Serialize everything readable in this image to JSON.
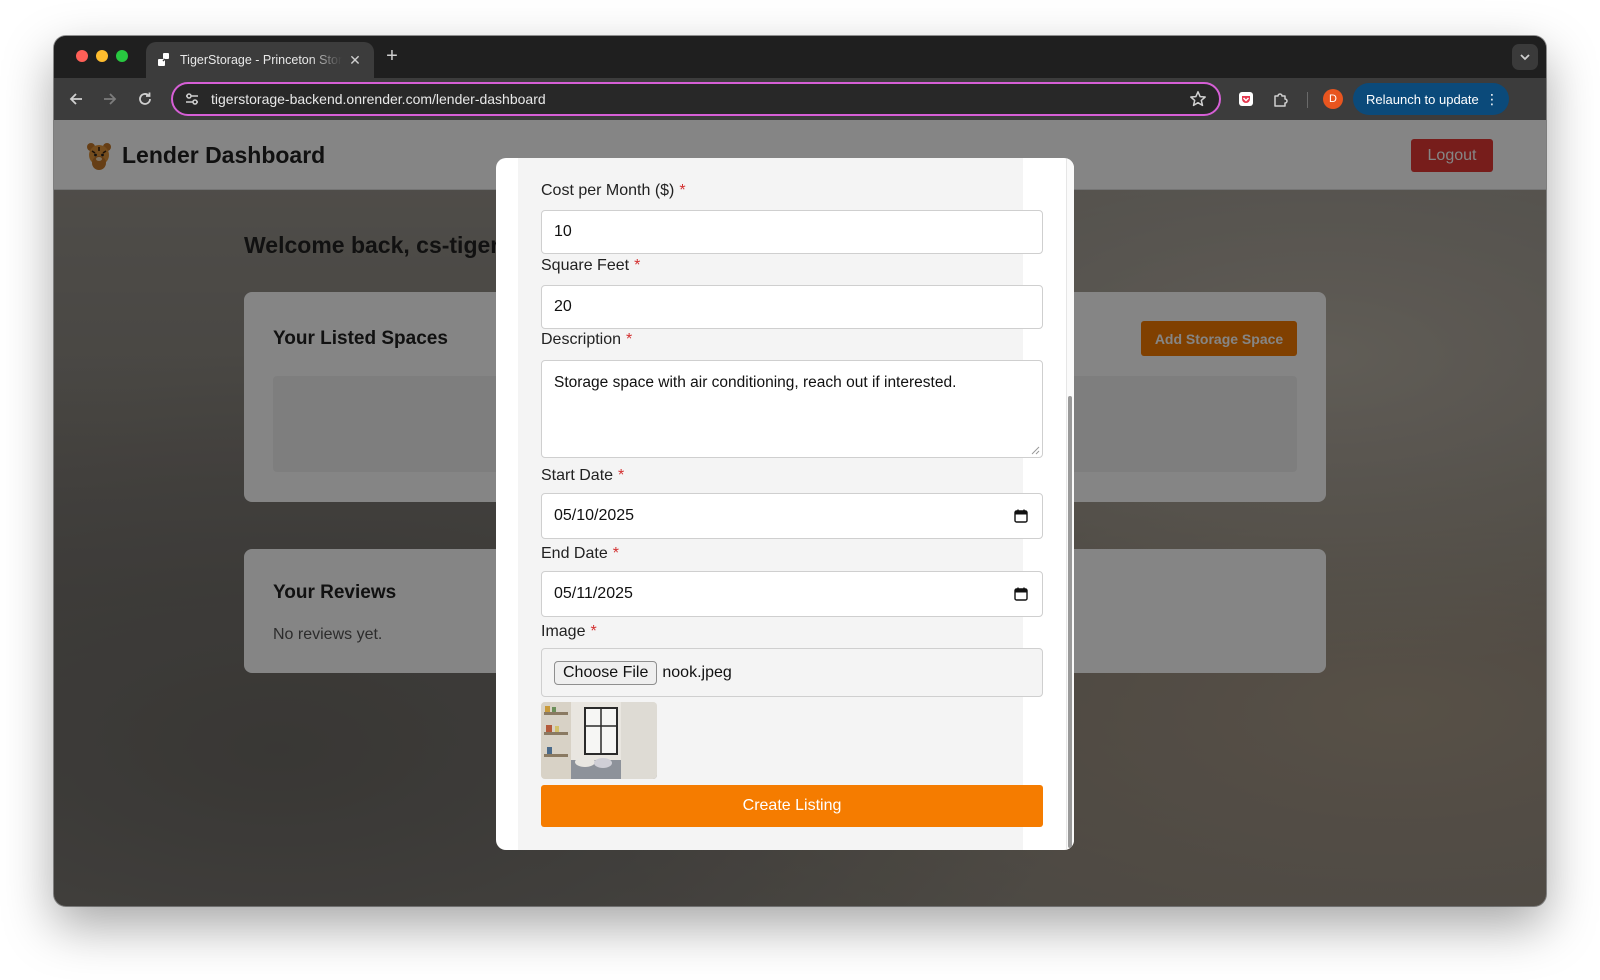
{
  "browser": {
    "tab_title": "TigerStorage - Princeton Storage",
    "url": "tigerstorage-backend.onrender.com/lender-dashboard",
    "relaunch_label": "Relaunch to update",
    "profile_initial": "D"
  },
  "header": {
    "title": "Lender Dashboard",
    "logout_label": "Logout"
  },
  "dashboard": {
    "welcome": "Welcome back, cs-tiger",
    "listed_title": "Your Listed Spaces",
    "add_space_label": "Add Storage Space",
    "reviews_title": "Your Reviews",
    "no_reviews": "No reviews yet."
  },
  "form": {
    "required_mark": "*",
    "cost_label": "Cost per Month ($)",
    "cost_value": "10",
    "sqft_label": "Square Feet",
    "sqft_value": "20",
    "description_label": "Description",
    "description_value": "Storage space with air conditioning, reach out if interested.",
    "start_label": "Start Date",
    "start_value": "05/10/2025",
    "end_label": "End Date",
    "end_value": "05/11/2025",
    "image_label": "Image",
    "choose_file_label": "Choose File",
    "file_name": "nook.jpeg",
    "submit_label": "Create Listing"
  },
  "colors": {
    "accent_orange": "#f57c00",
    "logout_red": "#e53935",
    "required_red": "#d32f2f",
    "omnibox_focus": "#d65fd6",
    "relaunch_blue": "#0b4a7a"
  },
  "icons": {
    "back": "arrow-left-icon",
    "forward": "arrow-right-icon",
    "reload": "reload-icon",
    "site_info": "tune-icon",
    "bookmark": "star-icon",
    "extension_1": "pocket-icon",
    "extension_2": "puzzle-icon",
    "calendar": "calendar-icon",
    "logo": "tiger-logo"
  }
}
